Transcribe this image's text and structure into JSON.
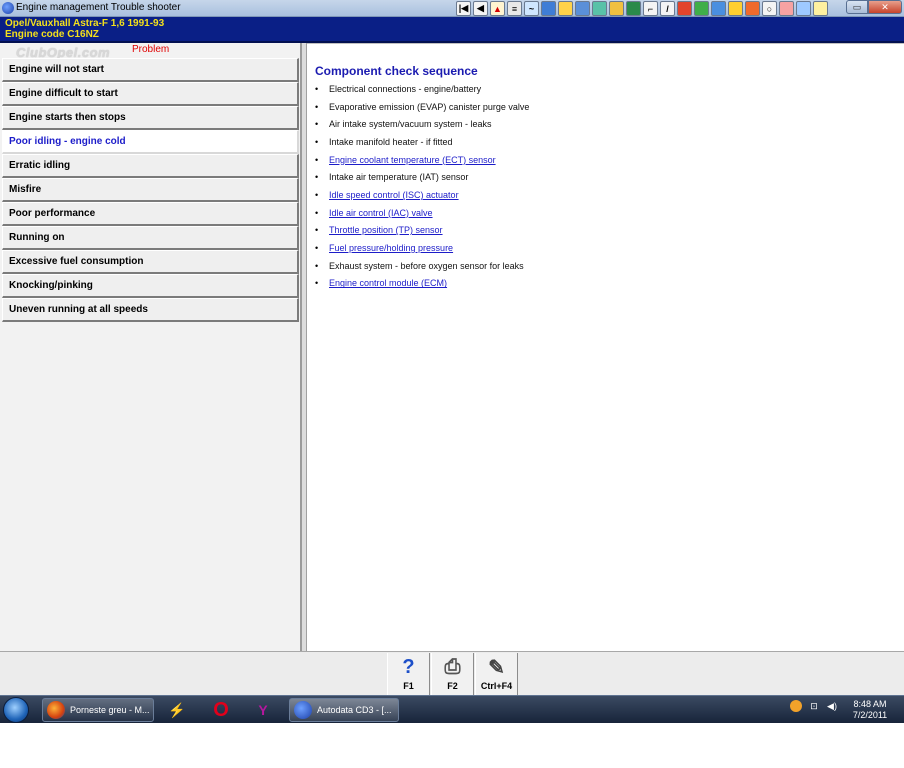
{
  "window": {
    "title": "Engine management Trouble shooter"
  },
  "header": {
    "vehicle": "Opel/Vauxhall  Astra-F  1,6  1991-93",
    "engine_code": "Engine code  C16NZ"
  },
  "left_panel": {
    "watermark": "ClubOpel.com",
    "problem_label": "Problem",
    "items": [
      {
        "label": "Engine will not start",
        "selected": false
      },
      {
        "label": "Engine difficult to start",
        "selected": false
      },
      {
        "label": "Engine starts then stops",
        "selected": false
      },
      {
        "label": "Poor idling - engine cold",
        "selected": true
      },
      {
        "label": "Erratic idling",
        "selected": false
      },
      {
        "label": "Misfire",
        "selected": false
      },
      {
        "label": "Poor performance",
        "selected": false
      },
      {
        "label": "Running on",
        "selected": false
      },
      {
        "label": "Excessive fuel consumption",
        "selected": false
      },
      {
        "label": "Knocking/pinking",
        "selected": false
      },
      {
        "label": "Uneven running at all speeds",
        "selected": false
      }
    ]
  },
  "right_panel": {
    "title": "Component check sequence",
    "bullet": "•",
    "items": [
      {
        "label": "Electrical connections - engine/battery",
        "link": false
      },
      {
        "label": "Evaporative emission (EVAP) canister purge valve",
        "link": false
      },
      {
        "label": "Air intake system/vacuum system - leaks",
        "link": false
      },
      {
        "label": "Intake manifold heater - if fitted",
        "link": false
      },
      {
        "label": "Engine coolant temperature (ECT) sensor",
        "link": true
      },
      {
        "label": "Intake air temperature (IAT) sensor",
        "link": false
      },
      {
        "label": "Idle speed control (ISC) actuator",
        "link": true
      },
      {
        "label": "Idle air control (IAC) valve",
        "link": true
      },
      {
        "label": "Throttle position (TP) sensor",
        "link": true
      },
      {
        "label": "Fuel pressure/holding pressure",
        "link": true
      },
      {
        "label": "Exhaust system - before oxygen sensor for leaks",
        "link": false
      },
      {
        "label": "Engine control module (ECM)",
        "link": true
      }
    ]
  },
  "function_bar": {
    "help": {
      "icon": "help-question-icon",
      "label": "F1"
    },
    "print": {
      "icon": "printer-icon",
      "label": "F2"
    },
    "notes": {
      "icon": "notepad-icon",
      "label": "Ctrl+F4"
    }
  },
  "taskbar": {
    "task1_label": "Porneste greu - M...",
    "task2_label": "Autodata CD3 - [...",
    "clock_time": "8:48 AM",
    "clock_date": "7/2/2011"
  },
  "colors": {
    "header_bg": "#0a1f86",
    "header_text": "#f3e01c",
    "title_blue": "#1b1bb0",
    "link_blue": "#1c1cc9",
    "problem_red": "#e00000"
  }
}
